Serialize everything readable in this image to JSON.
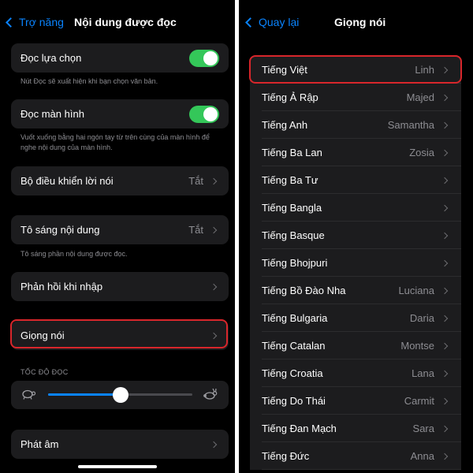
{
  "left": {
    "back_label": "Trợ năng",
    "title": "Nội dung được đọc",
    "speak_selection": {
      "label": "Đọc lựa chọn",
      "on": true
    },
    "speak_selection_note": "Nút Đọc sẽ xuất hiện khi bạn chọn văn bản.",
    "speak_screen": {
      "label": "Đọc màn hình",
      "on": true
    },
    "speak_screen_note": "Vuốt xuống bằng hai ngón tay từ trên cùng của màn hình để nghe nội dung của màn hình.",
    "speech_controller": {
      "label": "Bộ điều khiển lời nói",
      "value": "Tắt"
    },
    "highlight_content": {
      "label": "Tô sáng nội dung",
      "value": "Tắt"
    },
    "highlight_note": "Tô sáng phần nội dung được đọc.",
    "typing_feedback": {
      "label": "Phản hồi khi nhập"
    },
    "voices": {
      "label": "Giọng nói"
    },
    "rate_header": "TỐC ĐỘ ĐỌC",
    "rate_level": 0.5,
    "pronunciations": {
      "label": "Phát âm"
    }
  },
  "right": {
    "back_label": "Quay lại",
    "title": "Giọng nói",
    "languages": [
      {
        "label": "Tiếng Việt",
        "value": "Linh"
      },
      {
        "label": "Tiếng Ả Rập",
        "value": "Majed"
      },
      {
        "label": "Tiếng Anh",
        "value": "Samantha"
      },
      {
        "label": "Tiếng Ba Lan",
        "value": "Zosia"
      },
      {
        "label": "Tiếng Ba Tư",
        "value": ""
      },
      {
        "label": "Tiếng Bangla",
        "value": ""
      },
      {
        "label": "Tiếng Basque",
        "value": ""
      },
      {
        "label": "Tiếng Bhojpuri",
        "value": ""
      },
      {
        "label": "Tiếng Bồ Đào Nha",
        "value": "Luciana"
      },
      {
        "label": "Tiếng Bulgaria",
        "value": "Daria"
      },
      {
        "label": "Tiếng Catalan",
        "value": "Montse"
      },
      {
        "label": "Tiếng Croatia",
        "value": "Lana"
      },
      {
        "label": "Tiếng Do Thái",
        "value": "Carmit"
      },
      {
        "label": "Tiếng Đan Mạch",
        "value": "Sara"
      },
      {
        "label": "Tiếng Đức",
        "value": "Anna"
      }
    ]
  },
  "colors": {
    "accent": "#0a84ff",
    "toggle_on": "#34c759",
    "highlight_border": "#d8262b"
  }
}
